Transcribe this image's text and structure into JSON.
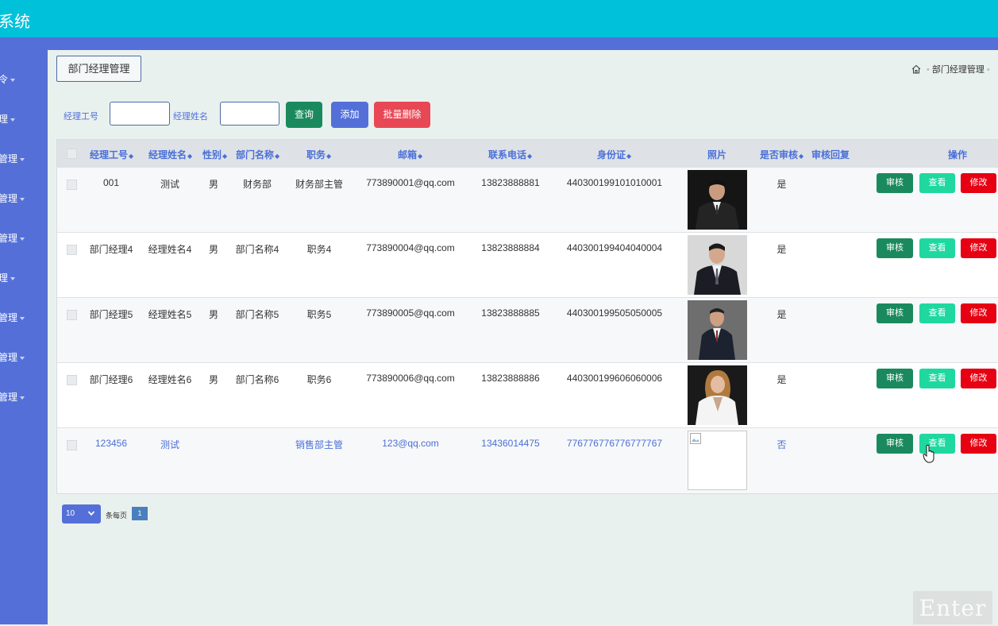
{
  "app": {
    "title": "系统"
  },
  "sidebar": {
    "items": [
      {
        "label": "令"
      },
      {
        "label": "理"
      },
      {
        "label": "管理"
      },
      {
        "label": "管理"
      },
      {
        "label": "管理"
      },
      {
        "label": "理"
      },
      {
        "label": "管理"
      },
      {
        "label": "管理"
      },
      {
        "label": "管理"
      }
    ]
  },
  "page": {
    "tab_label": "部门经理管理",
    "breadcrumb": {
      "current": "部门经理管理"
    }
  },
  "search": {
    "id_label": "经理工号",
    "id_value": "",
    "name_label": "经理姓名",
    "name_value": "",
    "query_label": "查询",
    "add_label": "添加",
    "batch_delete_label": "批量删除"
  },
  "table": {
    "headers": {
      "id": "经理工号",
      "name": "经理姓名",
      "gender": "性别",
      "dept": "部门名称",
      "position": "职务",
      "email": "邮箱",
      "phone": "联系电话",
      "idcard": "身份证",
      "photo": "照片",
      "audited": "是否审核",
      "reply": "审核回复",
      "actions": "操作"
    },
    "sort_icon": "sort-icon",
    "action_labels": {
      "audit": "审核",
      "view": "查看",
      "edit": "修改"
    },
    "rows": [
      {
        "id": "001",
        "name": "测试",
        "gender": "男",
        "dept": "财务部",
        "position": "财务部主管",
        "email": "773890001@qq.com",
        "phone": "13823888881",
        "idcard": "440300199101010001",
        "audited": "是",
        "reply": ""
      },
      {
        "id": "部门经理4",
        "name": "经理姓名4",
        "gender": "男",
        "dept": "部门名称4",
        "position": "职务4",
        "email": "773890004@qq.com",
        "phone": "13823888884",
        "idcard": "440300199404040004",
        "audited": "是",
        "reply": ""
      },
      {
        "id": "部门经理5",
        "name": "经理姓名5",
        "gender": "男",
        "dept": "部门名称5",
        "position": "职务5",
        "email": "773890005@qq.com",
        "phone": "13823888885",
        "idcard": "440300199505050005",
        "audited": "是",
        "reply": ""
      },
      {
        "id": "部门经理6",
        "name": "经理姓名6",
        "gender": "男",
        "dept": "部门名称6",
        "position": "职务6",
        "email": "773890006@qq.com",
        "phone": "13823888886",
        "idcard": "440300199606060006",
        "audited": "是",
        "reply": ""
      },
      {
        "id": "123456",
        "name": "测试",
        "gender": "",
        "dept": "",
        "position": "销售部主管",
        "email": "123@qq.com",
        "phone": "13436014475",
        "idcard": "776776776776777767",
        "audited": "否",
        "reply": ""
      }
    ]
  },
  "pager": {
    "page_size": "10",
    "per_page_label": "条每页",
    "current_page": "1"
  },
  "overlay": {
    "key_hint": "Enter"
  },
  "colors": {
    "topbar": "#00c1da",
    "sidebar": "#5470d8",
    "query": "#1a8a5e",
    "add": "#5470d8",
    "batch_delete": "#e84855",
    "audit": "#1a8a5e",
    "view": "#1ed8a0",
    "edit": "#e60012"
  }
}
